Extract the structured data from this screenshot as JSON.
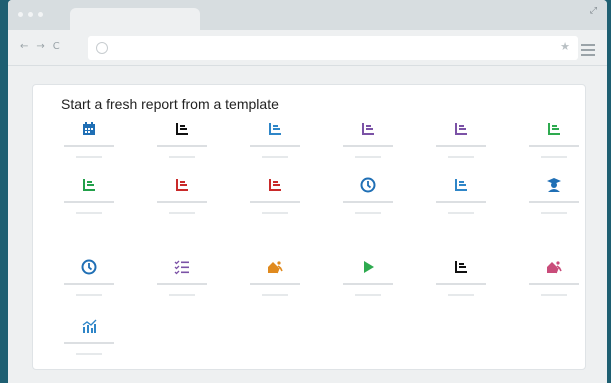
{
  "browser": {
    "nav": [
      "←",
      "→",
      "C"
    ],
    "star_icon": "★",
    "expand_icon": "⤢"
  },
  "page": {
    "heading": "Start a fresh report from a template"
  },
  "templates": [
    {
      "icon": "calendar-icon",
      "color": "#1f6fb5"
    },
    {
      "icon": "bar-chart-icon",
      "color": "#111111"
    },
    {
      "icon": "bar-chart-icon",
      "color": "#2f86c8"
    },
    {
      "icon": "bar-chart-icon",
      "color": "#7b52a6"
    },
    {
      "icon": "bar-chart-icon",
      "color": "#7b52a6"
    },
    {
      "icon": "bar-chart-icon",
      "color": "#2eaa4f"
    },
    {
      "icon": "bar-chart-icon",
      "color": "#22a04a"
    },
    {
      "icon": "bar-chart-icon",
      "color": "#c92a2a"
    },
    {
      "icon": "bar-chart-icon",
      "color": "#c92a2a"
    },
    {
      "icon": "clock-icon",
      "color": "#1f6fb5"
    },
    {
      "icon": "bar-chart-icon",
      "color": "#2f86c8"
    },
    {
      "icon": "graduate-icon",
      "color": "#1f6fb5"
    },
    {
      "icon": "clock-icon",
      "color": "#1f6fb5"
    },
    {
      "icon": "checklist-icon",
      "color": "#7b52a6"
    },
    {
      "icon": "running-house-icon",
      "color": "#e08a1e"
    },
    {
      "icon": "play-icon",
      "color": "#2eaa4f"
    },
    {
      "icon": "bar-chart-icon",
      "color": "#111111"
    },
    {
      "icon": "running-house-icon",
      "color": "#c94c7a"
    },
    {
      "icon": "trend-chart-icon",
      "color": "#2f86c8"
    }
  ]
}
